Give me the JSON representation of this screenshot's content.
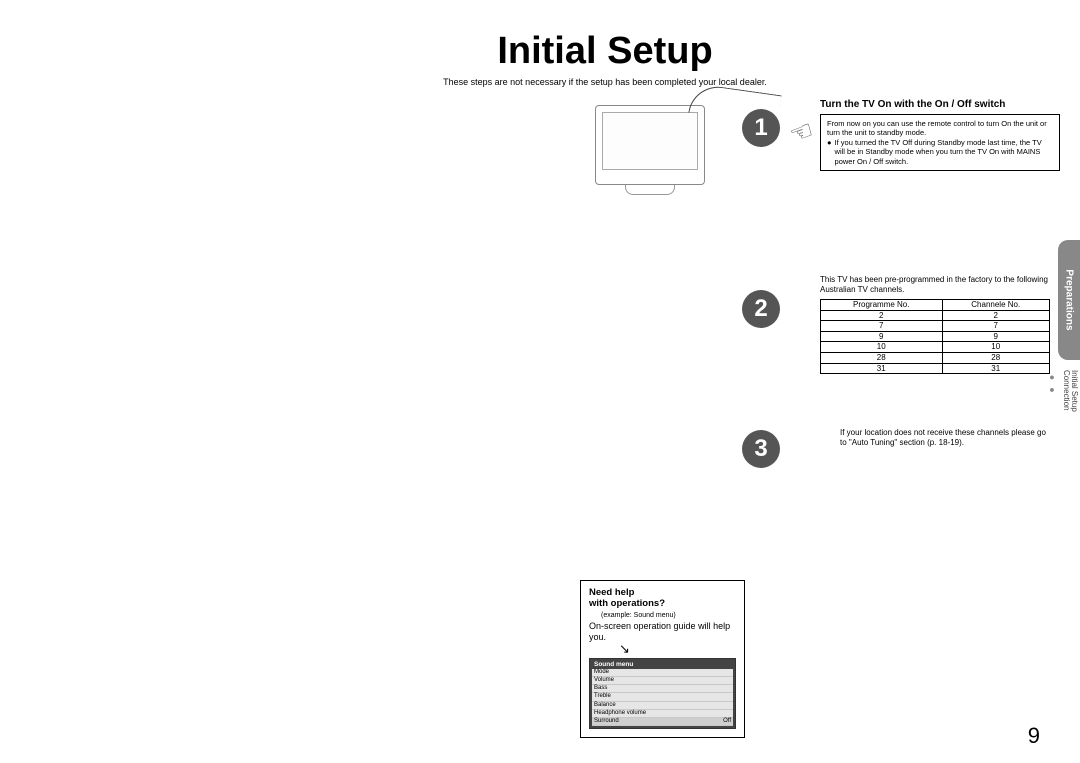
{
  "title": "Initial Setup",
  "intro": "These steps are not necessary if the setup has been completed your local dealer.",
  "steps": {
    "one": {
      "num": "1",
      "heading": "Turn the TV On with the On / Off switch",
      "body1": "From now on you can use the remote control to turn On the unit or turn the unit to standby mode.",
      "body2": "If you turned the TV Off during Standby mode last time, the TV will be in Standby mode when you turn the TV On with MAINS power On / Off switch."
    },
    "two": {
      "num": "2",
      "text": "This TV has been pre-programmed in the factory to the following Australian TV channels.",
      "table": {
        "h1": "Programme No.",
        "h2": "Channele No.",
        "rows": [
          {
            "p": "2",
            "c": "2"
          },
          {
            "p": "7",
            "c": "7"
          },
          {
            "p": "9",
            "c": "9"
          },
          {
            "p": "10",
            "c": "10"
          },
          {
            "p": "28",
            "c": "28"
          },
          {
            "p": "31",
            "c": "31"
          }
        ]
      }
    },
    "three": {
      "num": "3",
      "text": "If your location does not receive these channels please go to \"Auto Tuning\" section (p. 18-19)."
    }
  },
  "help": {
    "title1": "Need help",
    "title2": "with operations?",
    "example": "(example: Sound menu)",
    "desc": "On-screen operation guide will help you.",
    "menu": {
      "header": "Sound menu",
      "items": [
        {
          "k": "Mode",
          "v": ""
        },
        {
          "k": "Volume",
          "v": ""
        },
        {
          "k": "Bass",
          "v": ""
        },
        {
          "k": "Treble",
          "v": ""
        },
        {
          "k": "Balance",
          "v": ""
        },
        {
          "k": "Headphone volume",
          "v": ""
        },
        {
          "k": "Surround",
          "v": "Off"
        }
      ]
    }
  },
  "side": {
    "tab": "Preparations",
    "sub1": "Initial Setup",
    "sub2": "Connection",
    "dots": "● ●"
  },
  "pageNumber": "9"
}
